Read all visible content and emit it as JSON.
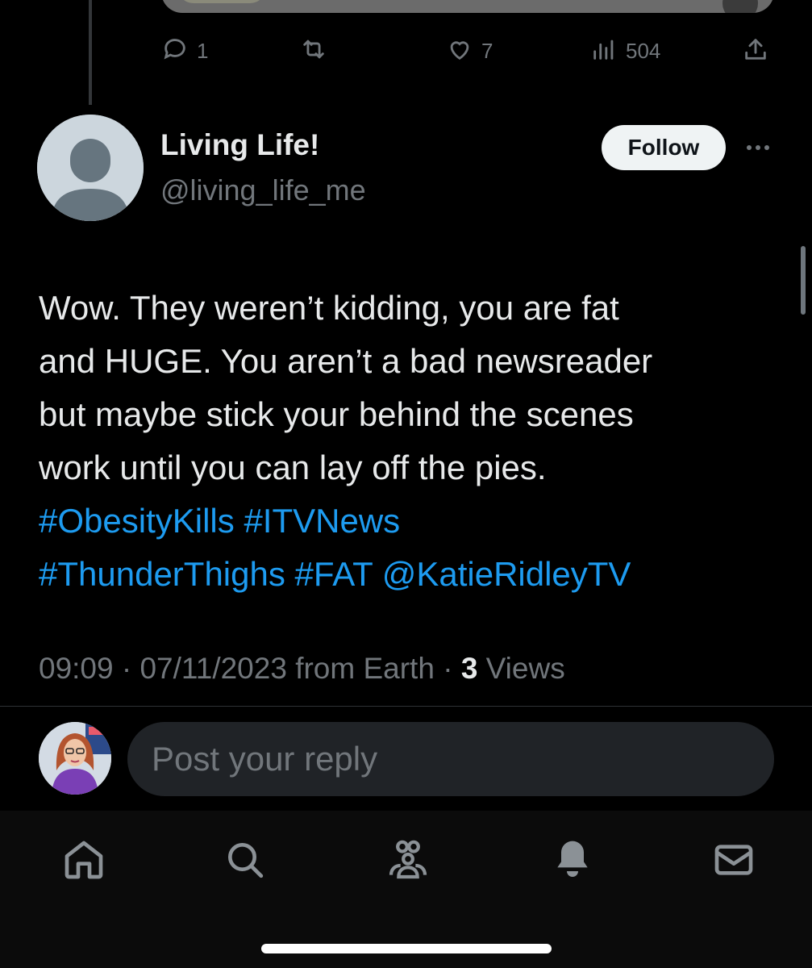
{
  "previous_tweet": {
    "actions": {
      "replies": "1",
      "reposts": "",
      "likes": "7",
      "views": "504"
    }
  },
  "tweet": {
    "author": {
      "display_name": "Living Life!",
      "handle": "@living_life_me",
      "follow_label": "Follow"
    },
    "text_lines": [
      "Wow. They weren’t kidding, you are fat",
      "and HUGE. You aren’t a bad newsreader",
      "but maybe stick your behind the scenes",
      "work until you can lay off the pies."
    ],
    "hashtags_line1": [
      "#ObesityKills",
      "#ITVNews"
    ],
    "hashtags_line2": [
      "#ThunderThighs",
      "#FAT",
      "@KatieRidleyTV"
    ],
    "meta": {
      "time": "09:09",
      "separator": "·",
      "date": "07/11/2023",
      "source": "from Earth",
      "views_count": "3",
      "views_label": "Views"
    }
  },
  "reply": {
    "placeholder": "Post your reply"
  },
  "colors": {
    "background": "#000000",
    "link": "#1d9bf0",
    "muted": "#71767b"
  },
  "nav": [
    "home-icon",
    "search-icon",
    "communities-icon",
    "notifications-icon",
    "messages-icon"
  ]
}
